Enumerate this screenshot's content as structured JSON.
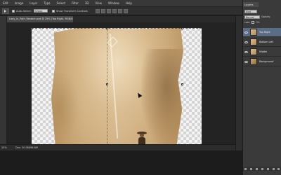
{
  "menu": [
    "Edit",
    "Image",
    "Layer",
    "Type",
    "Select",
    "Filter",
    "3D",
    "View",
    "Window",
    "Help"
  ],
  "options": {
    "auto_select_label": "Auto-Select:",
    "auto_select_value": "Group",
    "show_transform_label": "Show Transform Controls"
  },
  "document": {
    "tab_title": "Lady_in_Path_Restore.psd @ 25% (Top Right, RGB/8) *",
    "zoom": "25%",
    "doc_info": "Doc: 30.0M/96.8M"
  },
  "layers_panel": {
    "tab_label": "Layers",
    "filter_value": "Kind",
    "blend_mode": "Normal",
    "opacity_label": "Opacity:",
    "lock_label": "Lock:",
    "fill_label": "Fill:",
    "layers": [
      {
        "name": "Top Right",
        "selected": true
      },
      {
        "name": "Bottom Left",
        "selected": false
      },
      {
        "name": "Middle",
        "selected": false
      },
      {
        "name": "Background",
        "selected": false
      }
    ]
  },
  "colors": {
    "ui_dark": "#2f2f2f",
    "selection": "#5b6c85"
  }
}
